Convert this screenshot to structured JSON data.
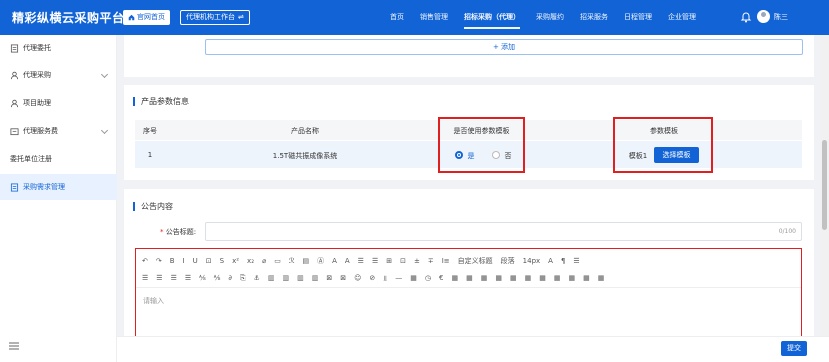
{
  "header": {
    "brand": "精彩纵横云采购平台",
    "home_chip": "官网首页",
    "workspace_chip": "代理机构工作台",
    "nav": [
      "首页",
      "销售管理",
      "招标采购（代理）",
      "采购履约",
      "招采服务",
      "日程管理",
      "企业管理"
    ],
    "active_nav": "招标采购（代理）",
    "username": "陈三",
    "accent": "#1264d6"
  },
  "sidebar": {
    "items": [
      {
        "label": "代理委托",
        "icon": "document-icon",
        "expandable": false
      },
      {
        "label": "代理采购",
        "icon": "user-icon",
        "expandable": true
      },
      {
        "label": "项目助理",
        "icon": "user-icon",
        "expandable": false
      },
      {
        "label": "代理服务费",
        "icon": "wallet-icon",
        "expandable": true
      },
      {
        "label": "委托单位注册",
        "icon": "",
        "expandable": false
      },
      {
        "label": "采购需求管理",
        "icon": "list-icon",
        "expandable": false
      }
    ],
    "active": "采购需求管理"
  },
  "top_card": {
    "add_label": "+ 添加"
  },
  "params_section": {
    "title": "产品参数信息",
    "columns": [
      "序号",
      "产品名称",
      "是否使用参数模板",
      "参数模板"
    ],
    "rows": [
      {
        "index": "1",
        "product": "1.5T磁共振成像系统",
        "use_yes": "是",
        "use_no": "否",
        "selected": "是",
        "template": "模板1",
        "choose_label": "选择模板"
      }
    ]
  },
  "announcement": {
    "title": "公告内容",
    "title_label": "公告标题:",
    "required_mark": "*",
    "counter": "0/100",
    "editor_placeholder": "请输入",
    "toolbar_row1": [
      "↶",
      "↷",
      "B",
      "I",
      "U",
      "⊡",
      "S",
      "x²",
      "x₂",
      "⌀",
      "▭",
      "ℛ",
      "▤",
      "Ⓐ",
      "A",
      "A",
      "☰",
      "☰",
      "⊞",
      "⊡",
      "±",
      "∓",
      "I≡",
      "自定义标题",
      "段落",
      "14px",
      "A",
      "¶",
      "☰"
    ],
    "toolbar_row2": [
      "☰",
      "☰",
      "☰",
      "☰",
      "⅍",
      "⅍",
      "∂",
      "⎘",
      "⚓",
      "▥",
      "▥",
      "▥",
      "▥",
      "⊠",
      "⊠",
      "☺",
      "⊘",
      "⫫",
      "—",
      "▦",
      "◷",
      "€",
      "▦",
      "▦",
      "▦",
      "▦",
      "▦",
      "▦",
      "▦",
      "▦",
      "▦",
      "▦",
      "▦"
    ]
  },
  "footer": {
    "submit_label": "提交"
  }
}
